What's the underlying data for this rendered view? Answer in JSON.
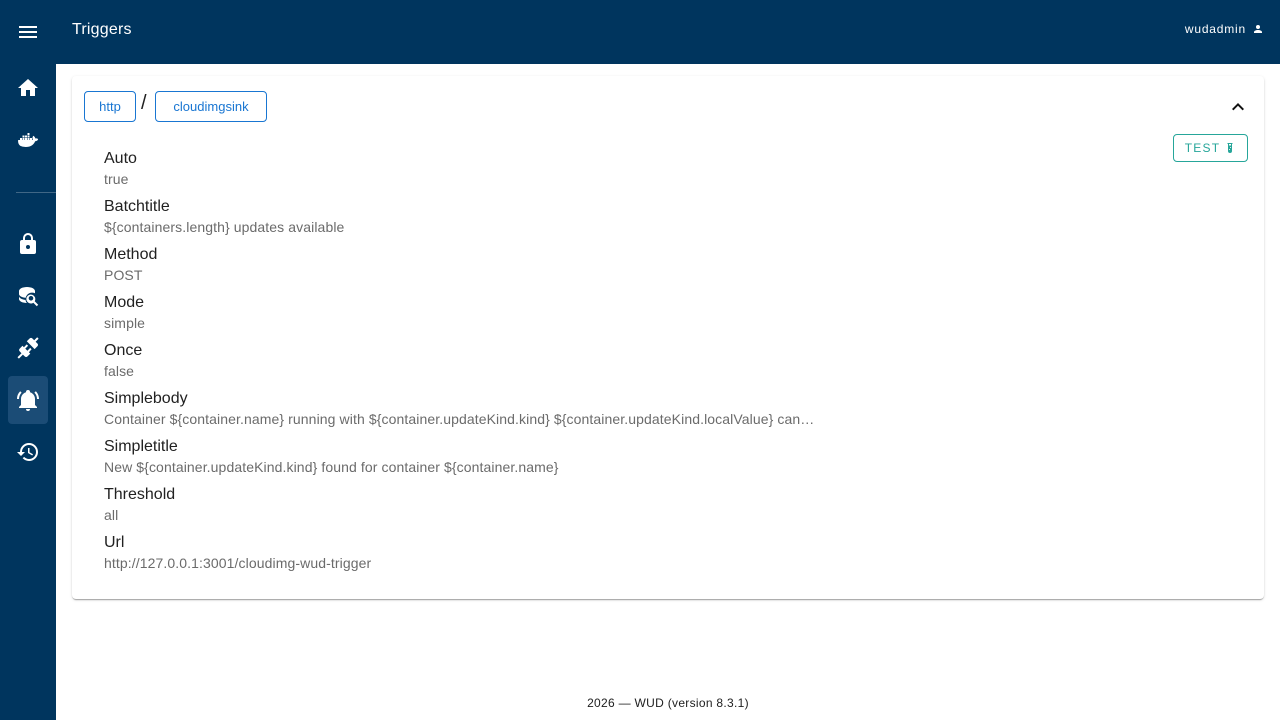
{
  "appbar": {
    "title": "Triggers",
    "user": "wudadmin"
  },
  "nav": {
    "items": [
      {
        "icon": "menu-icon"
      },
      {
        "icon": "home-icon"
      },
      {
        "icon": "docker-icon"
      },
      {
        "icon": "lock-icon"
      },
      {
        "icon": "database-search-icon"
      },
      {
        "icon": "plugin-icon"
      },
      {
        "icon": "bell-ring-icon",
        "active": true
      },
      {
        "icon": "history-icon"
      }
    ]
  },
  "trigger": {
    "type": "http",
    "separator": "/",
    "name": "cloudimgsink",
    "test_label": "TEST",
    "properties": [
      {
        "label": "Auto",
        "value": "true"
      },
      {
        "label": "Batchtitle",
        "value": "${containers.length} updates available"
      },
      {
        "label": "Method",
        "value": "POST"
      },
      {
        "label": "Mode",
        "value": "simple"
      },
      {
        "label": "Once",
        "value": "false"
      },
      {
        "label": "Simplebody",
        "value": "Container ${container.name} running with ${container.updateKind.kind} ${container.updateKind.localValue} can…"
      },
      {
        "label": "Simpletitle",
        "value": "New ${container.updateKind.kind} found for container ${container.name}"
      },
      {
        "label": "Threshold",
        "value": "all"
      },
      {
        "label": "Url",
        "value": "http://127.0.0.1:3001/cloudimg-wud-trigger"
      }
    ]
  },
  "footer": {
    "text": "2026 — WUD (version 8.3.1)"
  },
  "colors": {
    "primary": "#00355e",
    "accent": "#1976d2",
    "test": "#26a69a"
  }
}
